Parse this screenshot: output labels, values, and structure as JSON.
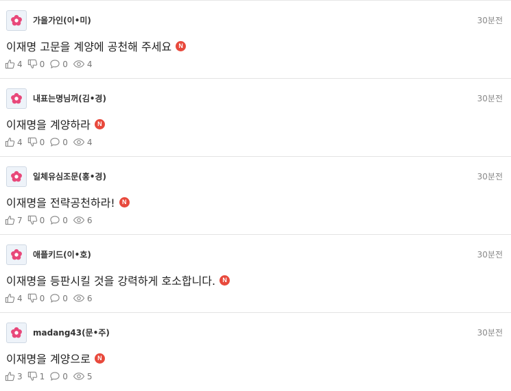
{
  "comments": [
    {
      "author": "가을가인(이•미)",
      "time": "30분전",
      "content": "이재명 고문을 계양에 공천해 주세요",
      "badge": "N",
      "likes": "4",
      "dislikes": "0",
      "replies": "0",
      "views": "4"
    },
    {
      "author": "내표는명님꺼(김•경)",
      "time": "30분전",
      "content": "이재명을 계양하라",
      "badge": "N",
      "likes": "4",
      "dislikes": "0",
      "replies": "0",
      "views": "4"
    },
    {
      "author": "일체유심조문(홍•경)",
      "time": "30분전",
      "content": "이재명을 전략공천하라!",
      "badge": "N",
      "likes": "7",
      "dislikes": "0",
      "replies": "0",
      "views": "6"
    },
    {
      "author": "애플키드(이•호)",
      "time": "30분전",
      "content": "이재명을 등판시킬 것을 강력하게 호소합니다.",
      "badge": "N",
      "likes": "4",
      "dislikes": "0",
      "replies": "0",
      "views": "6"
    },
    {
      "author": "madang43(문•주)",
      "time": "30분전",
      "content": "이재명을 계양으로",
      "badge": "N",
      "likes": "3",
      "dislikes": "1",
      "replies": "0",
      "views": "5"
    }
  ],
  "icons": {
    "avatar": "flower-icon",
    "like": "thumbs-up-icon",
    "dislike": "thumbs-down-icon",
    "reply": "speech-bubble-icon",
    "views": "eye-icon"
  },
  "colors": {
    "avatar_flower": "#e8487a",
    "new_badge": "#e8493c",
    "time_text": "#888888"
  }
}
